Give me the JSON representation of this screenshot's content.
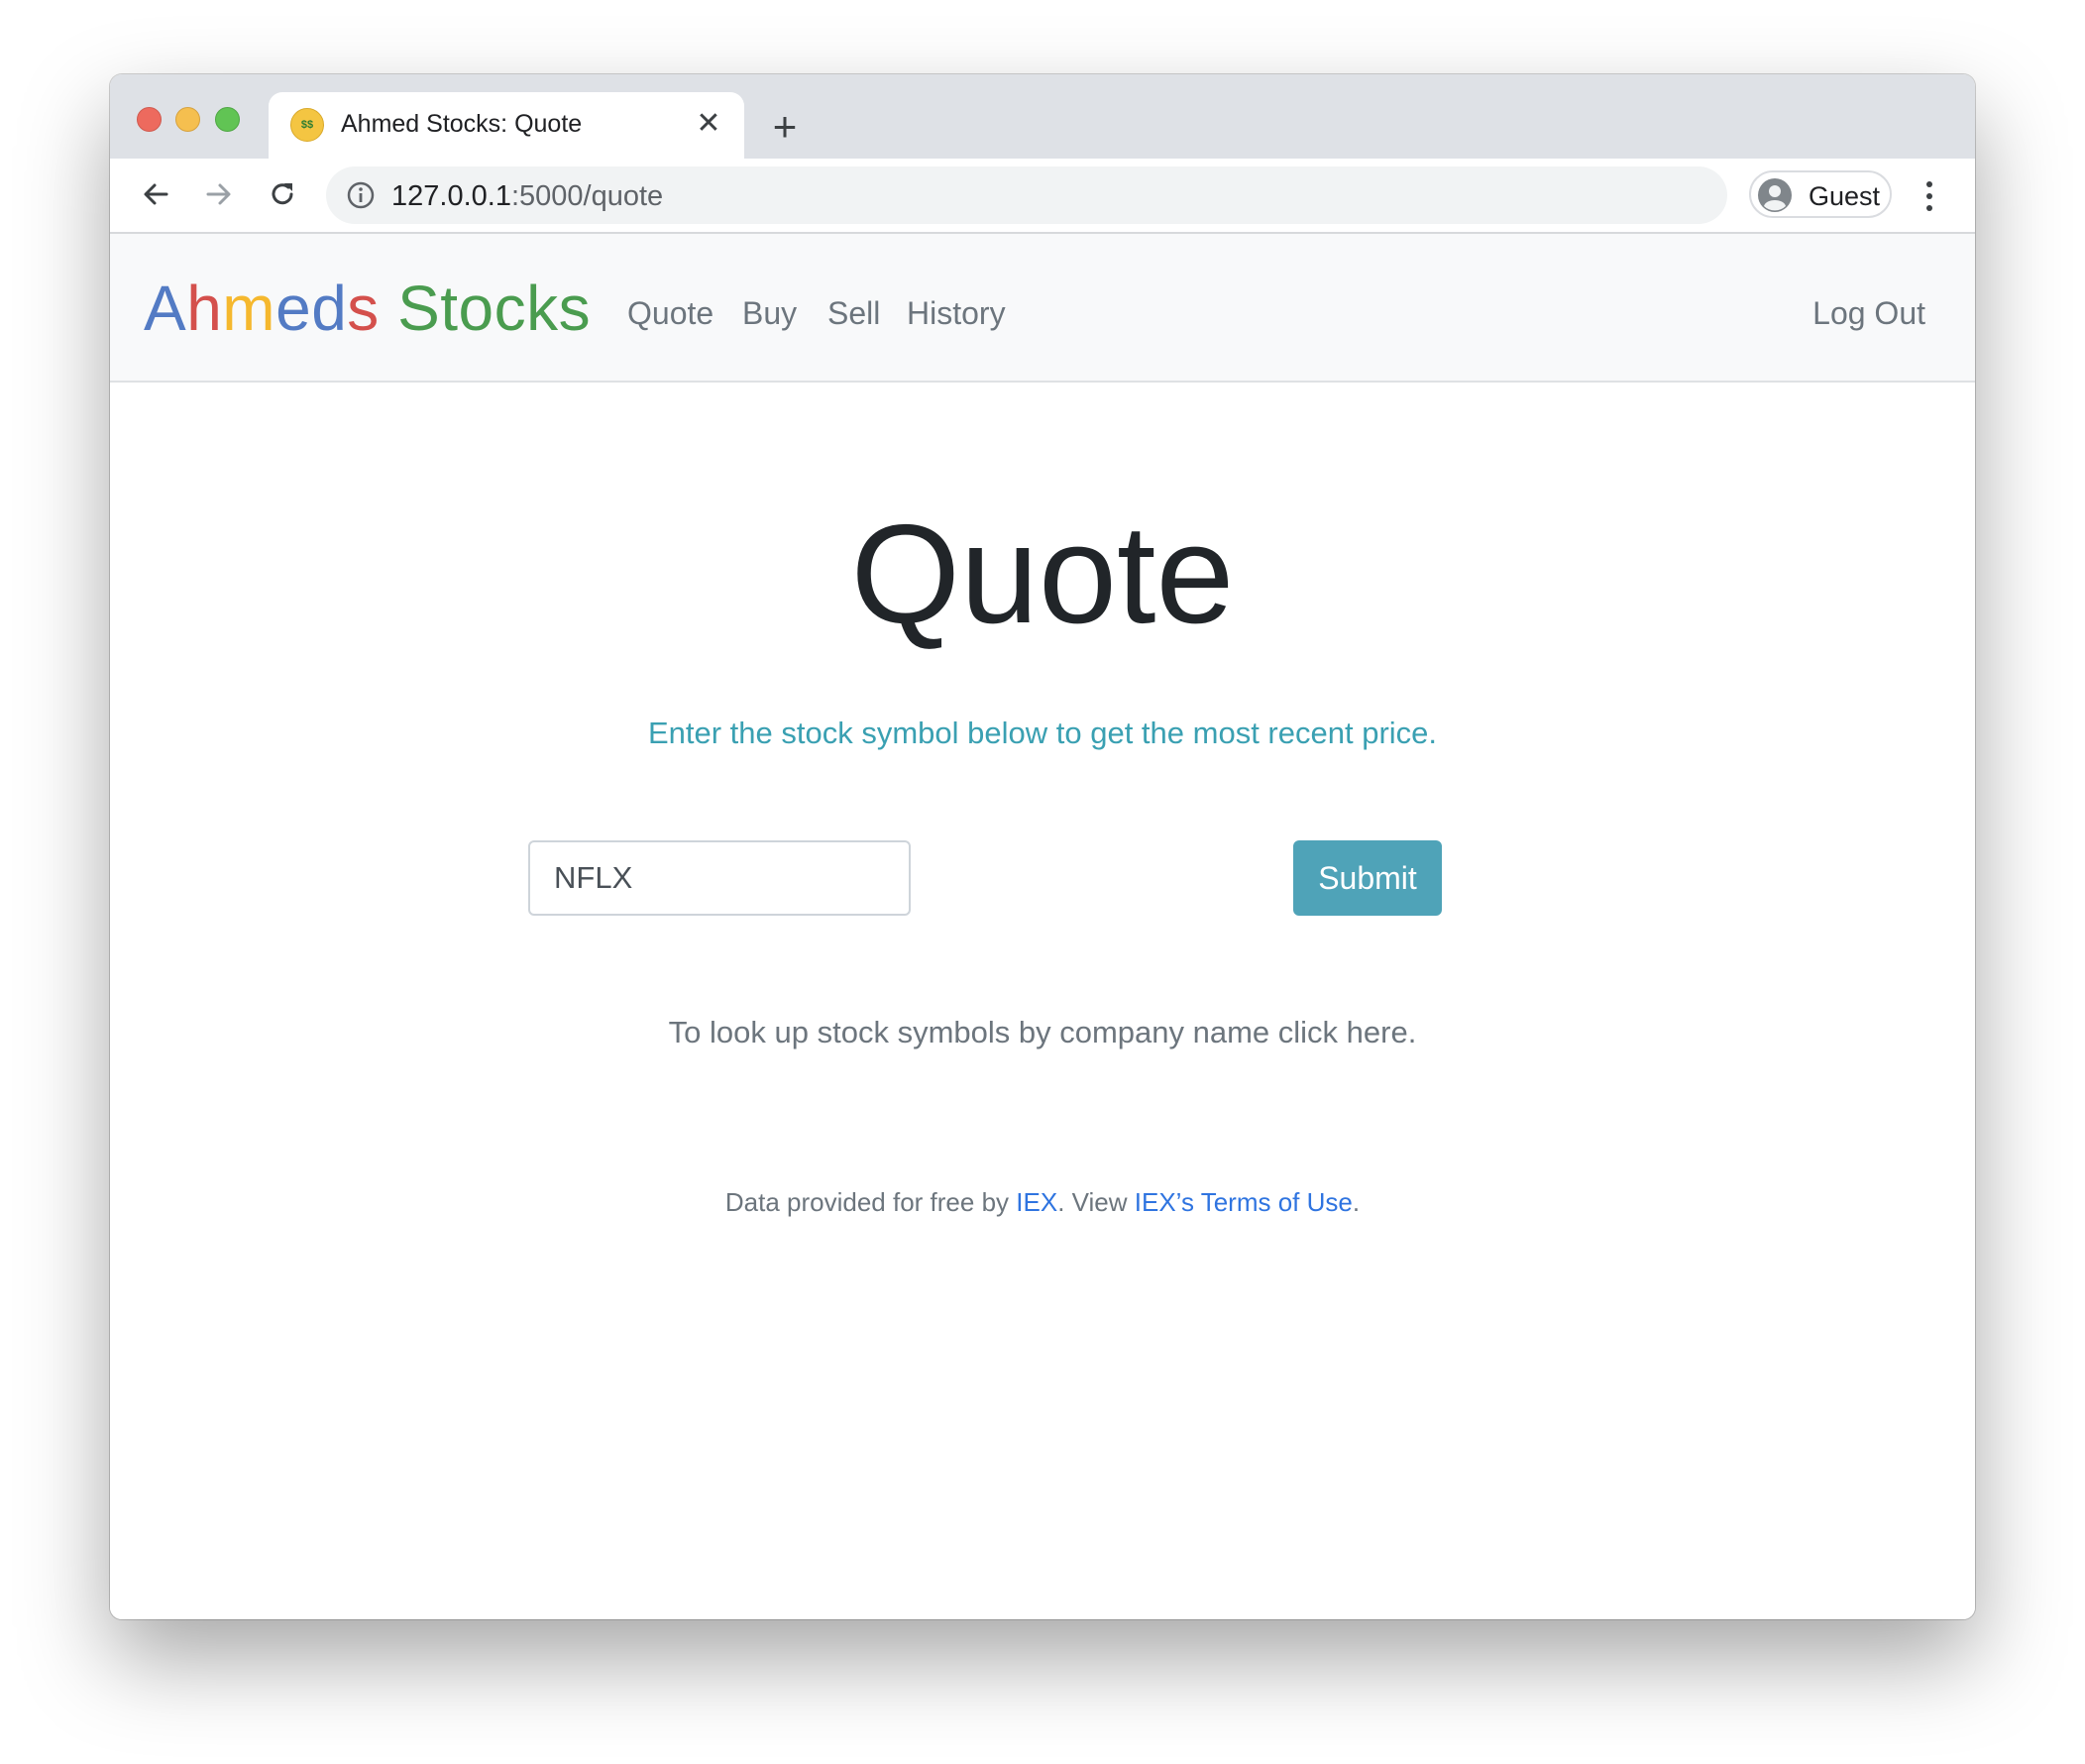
{
  "browser": {
    "tab": {
      "title": "Ahmed Stocks: Quote",
      "favicon": "money-mouth-face-emoji"
    },
    "url": {
      "host": "127.0.0.1",
      "path": ":5000/quote"
    },
    "profile": {
      "name": "Guest"
    }
  },
  "site": {
    "brand": {
      "letters": [
        {
          "char": "A",
          "color": "#537bc4"
        },
        {
          "char": "h",
          "color": "#d4504c"
        },
        {
          "char": "m",
          "color": "#f5b82e"
        },
        {
          "char": "e",
          "color": "#537bc4"
        },
        {
          "char": "d",
          "color": "#537bc4"
        },
        {
          "char": "s",
          "color": "#d4504c"
        }
      ],
      "second_word": "Stocks",
      "second_word_color": "#4a9c4f"
    },
    "nav": {
      "quote": "Quote",
      "buy": "Buy",
      "sell": "Sell",
      "history": "History",
      "logout": "Log Out"
    }
  },
  "main": {
    "heading": "Quote",
    "lead": "Enter the stock symbol below to get the most recent price.",
    "symbol_input": {
      "value": "NFLX"
    },
    "submit_label": "Submit",
    "lookup_text": "To look up stock symbols by company name click here."
  },
  "footer": {
    "prefix": "Data provided for free by ",
    "iex_link": "IEX",
    "middle": ". View ",
    "terms_link": "IEX’s Terms of Use",
    "suffix": "."
  },
  "colors": {
    "lead_text": "#3aa0b2",
    "submit_button": "#4fa3b8",
    "link": "#2f74e0"
  }
}
